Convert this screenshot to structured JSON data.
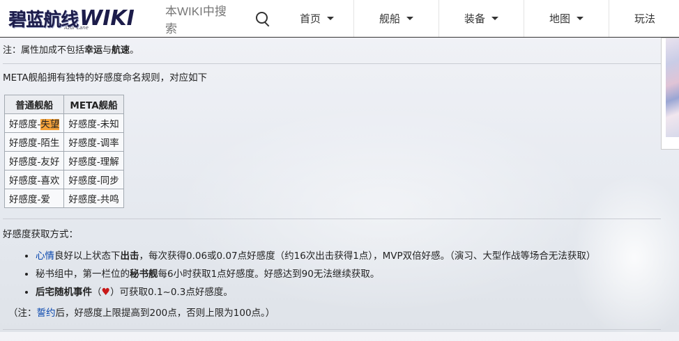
{
  "nav": {
    "logo": "碧蓝航线",
    "logo_wiki": "WIKI",
    "logo_sub": "Azur Lane",
    "search_placeholder": "本WIKI中搜索",
    "items": [
      {
        "label": "首页"
      },
      {
        "label": "舰船"
      },
      {
        "label": "装备"
      },
      {
        "label": "地图"
      },
      {
        "label": "玩法"
      }
    ]
  },
  "note": {
    "prefix": "注：属性加成不包括",
    "luck": "幸运",
    "and": "与",
    "speed": "航速",
    "end": "。"
  },
  "meta_intro": "META舰船拥有独特的好感度命名规则，对应如下",
  "table": {
    "headers": [
      "普通舰船",
      "META舰船"
    ],
    "rows": [
      {
        "normal_prefix": "好感度-",
        "normal_value": "失望",
        "meta": "好感度-未知"
      },
      {
        "normal": "好感度-陌生",
        "meta": "好感度-调率"
      },
      {
        "normal": "好感度-友好",
        "meta": "好感度-理解"
      },
      {
        "normal": "好感度-喜欢",
        "meta": "好感度-同步"
      },
      {
        "normal": "好感度-爱",
        "meta": "好感度-共鸣"
      }
    ]
  },
  "methods_title": "好感度获取方式：",
  "methods": {
    "m1": {
      "link": "心情",
      "t1": "良好以上状态下",
      "bold": "出击",
      "t2": "，每次获得0.06或0.07点好感度（约16次出击获得1点），MVP双倍好感。（演习、大型作战等场合无法获取）"
    },
    "m2": {
      "t1": "秘书组中，第一栏位的",
      "bold": "秘书舰",
      "t2": "每6小时获取1点好感度。好感达到90无法继续获取。"
    },
    "m3": {
      "bold": "后宅随机事件",
      "t1": "（",
      "heart": "♥",
      "t2": "）可获取0.1~0.3点好感度。"
    }
  },
  "footnote": {
    "t1": "（注：",
    "link": "誓约",
    "t2": "后，好感度上限提高到200点，否则上限为100点。）"
  },
  "colors": {
    "link": "#0645ad",
    "highlight": "#f6a33a",
    "heart": "#c81818"
  }
}
